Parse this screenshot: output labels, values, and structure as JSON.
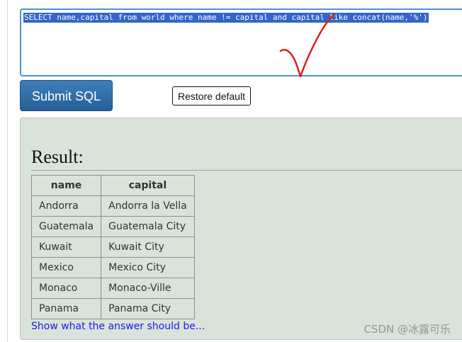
{
  "editor": {
    "sql": "SELECT name,capital from world where name != capital and capital like concat(name,'%')"
  },
  "buttons": {
    "submit_label": "Submit SQL",
    "restore_label": "Restore default"
  },
  "result": {
    "title": "Result:",
    "columns": [
      "name",
      "capital"
    ],
    "rows": [
      [
        "Andorra",
        "Andorra la Vella"
      ],
      [
        "Guatemala",
        "Guatemala City"
      ],
      [
        "Kuwait",
        "Kuwait City"
      ],
      [
        "Mexico",
        "Mexico City"
      ],
      [
        "Monaco",
        "Monaco-Ville"
      ],
      [
        "Panama",
        "Panama City"
      ]
    ],
    "answer_link": "Show what the answer should be..."
  },
  "watermark": "CSDN @冰露可乐",
  "colors": {
    "selection": "#3166c8",
    "submit_button": "#2f6ca8",
    "result_background": "#d9e3d9",
    "link": "#1a1aee",
    "check_mark": "#e0201b"
  },
  "icons": {
    "annotation": "red-check-mark"
  }
}
